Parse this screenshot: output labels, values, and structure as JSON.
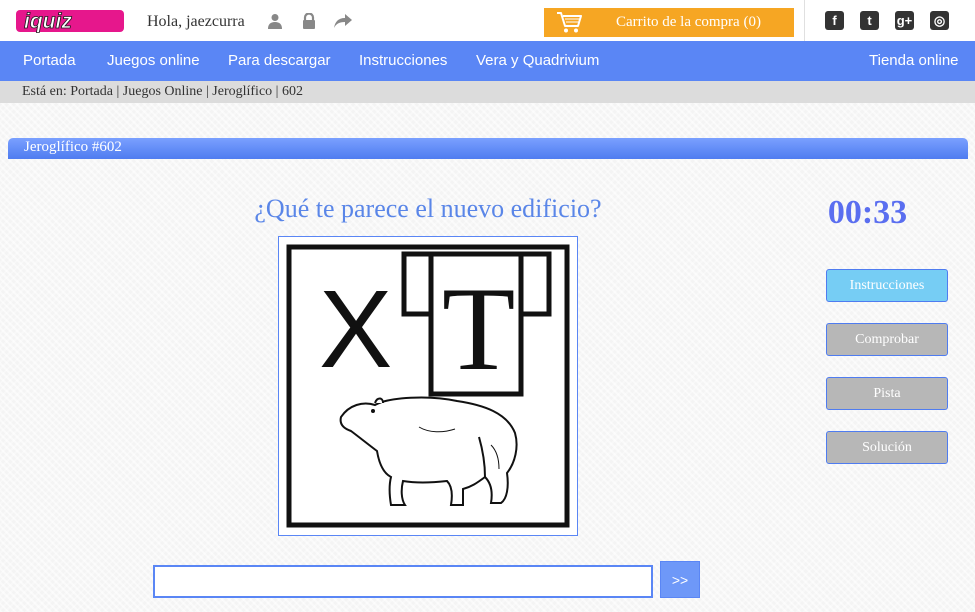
{
  "header": {
    "logo_text": "iquiz",
    "greeting": "Hola, jaezcurra",
    "cart_label": "Carrito de la compra (0)",
    "icons": [
      "user-icon",
      "lock-icon",
      "share-icon"
    ],
    "social": [
      "facebook-icon",
      "twitter-icon",
      "googleplus-icon",
      "instagram-icon"
    ],
    "social_glyphs": [
      "f",
      "t",
      "g+",
      "◎"
    ]
  },
  "nav": {
    "items": [
      "Portada",
      "Juegos online",
      "Para descargar",
      "Instrucciones",
      "Vera y Quadrivium"
    ],
    "right_item": "Tienda online"
  },
  "breadcrumb": "Está en: Portada | Juegos Online | Jeroglífico | 602",
  "puzzle": {
    "header": "Jeroglífico #602",
    "question": "¿Qué te parece el nuevo edificio?",
    "image_letters": [
      "X",
      "T"
    ],
    "timer": "00:33"
  },
  "buttons": {
    "instructions": "Instrucciones",
    "check": "Comprobar",
    "hint": "Pista",
    "solution": "Solución",
    "submit": ">>"
  },
  "answer": {
    "value": "",
    "placeholder": ""
  },
  "colors": {
    "nav_bg": "#5a86f5",
    "cart_bg": "#f6a623",
    "logo_pink": "#e6178c",
    "question_blue": "#5a86e8"
  }
}
